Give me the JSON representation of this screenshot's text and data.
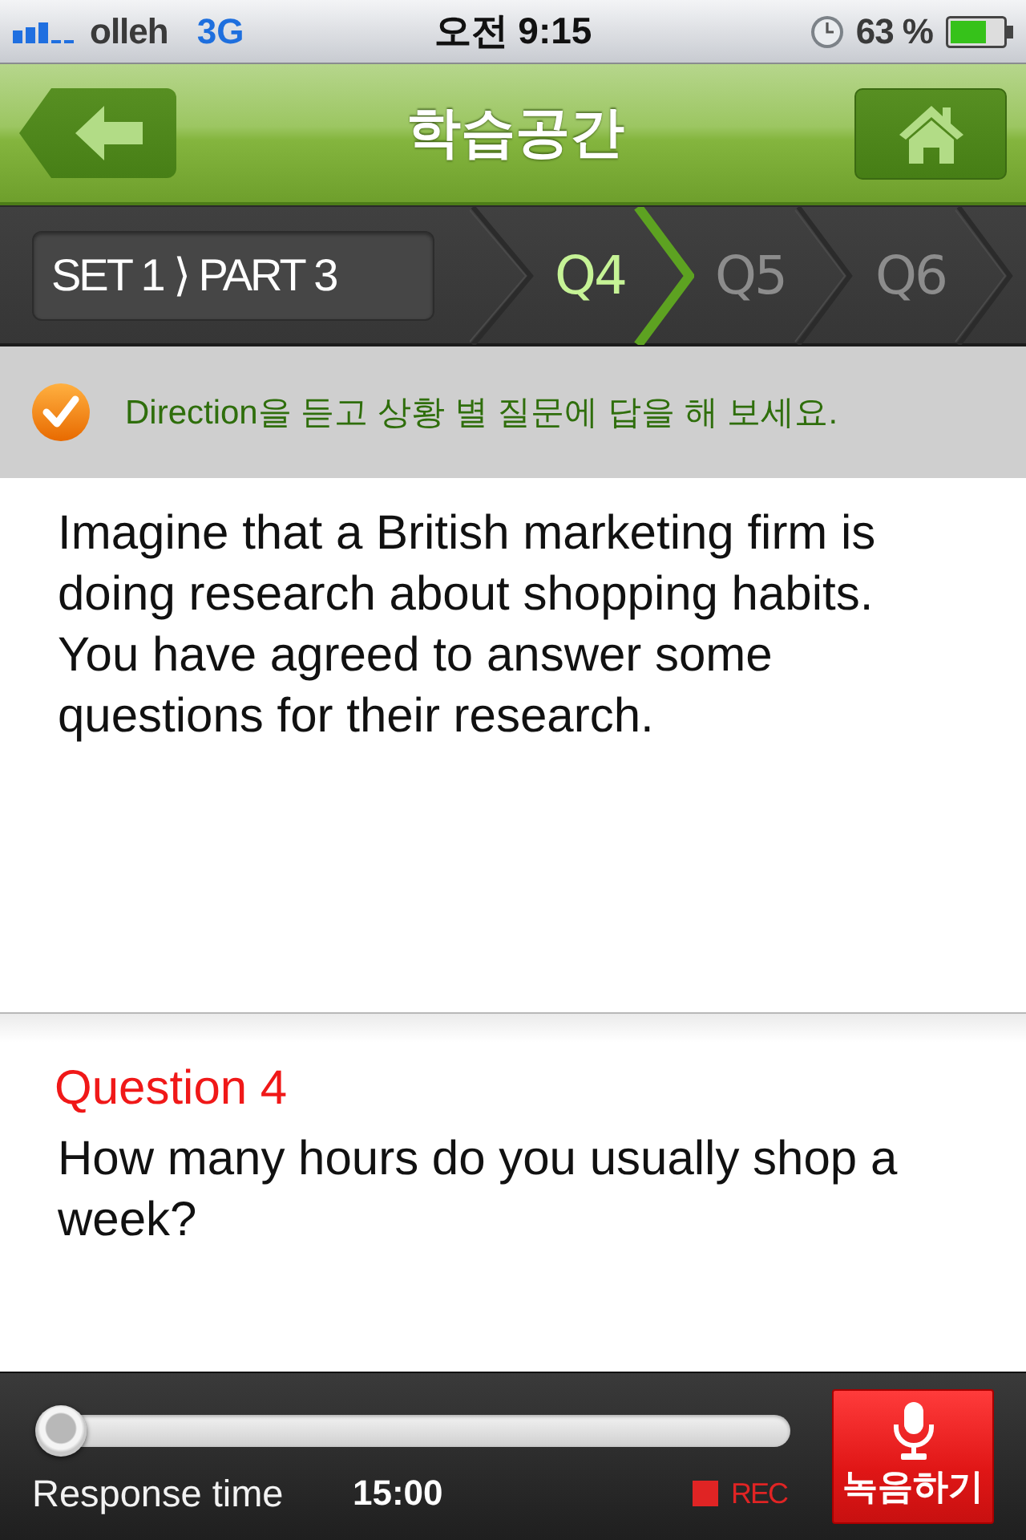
{
  "status_bar": {
    "carrier": "olleh",
    "network": "3G",
    "time": "오전 9:15",
    "battery": "63 %"
  },
  "nav_bar": {
    "title": "학습공간"
  },
  "progress": {
    "breadcrumb": "SET 1 ⟩ PART 3",
    "steps": [
      {
        "label": "Q4",
        "selected": true
      },
      {
        "label": "Q5",
        "selected": false
      },
      {
        "label": "Q6",
        "selected": false
      }
    ]
  },
  "direction": {
    "text": "Direction을 듣고 상황 별 질문에 답을 해 보세요."
  },
  "passage": "Imagine that a British marketing firm is doing research about shopping habits. You have agreed to answer some questions for their research.",
  "question": {
    "label": "Question 4",
    "text": "How many hours do you usually shop a week?"
  },
  "recorder": {
    "level": 0,
    "response_label": "Response time",
    "response_time": "15:00",
    "rec_label": "REC",
    "record_button": "녹음하기"
  }
}
